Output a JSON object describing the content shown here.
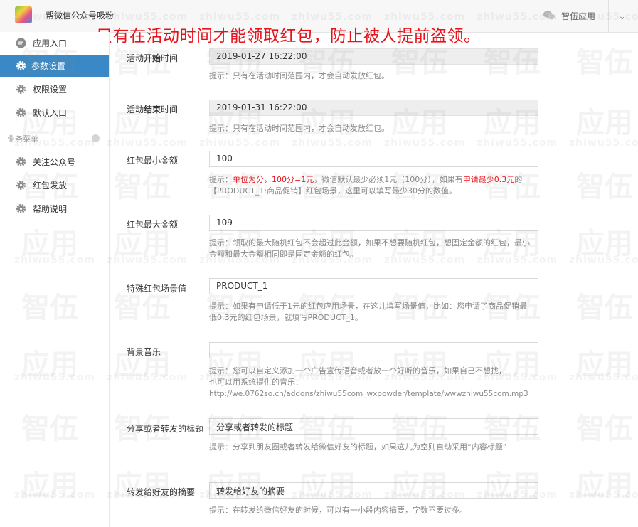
{
  "header": {
    "app_title": "帮微信公众号吸粉",
    "account_name": "智伍应用",
    "banner": "只有在活动时间才能领取红包，防止被人提前盗领。"
  },
  "sidebar": {
    "items": [
      {
        "label": "应用入口",
        "icon": "chat-bubble-icon",
        "active": false
      },
      {
        "label": "参数设置",
        "icon": "gear-icon",
        "active": true
      },
      {
        "label": "权限设置",
        "icon": "gear-icon",
        "active": false
      },
      {
        "label": "默认入口",
        "icon": "gear-icon",
        "active": false
      }
    ],
    "section_title": "业务菜单",
    "section_items": [
      {
        "label": "关注公众号",
        "icon": "gear-icon"
      },
      {
        "label": "红包发放",
        "icon": "gear-icon"
      },
      {
        "label": "帮助说明",
        "icon": "gear-icon"
      }
    ]
  },
  "form": {
    "start_time": {
      "label_pre": "活动",
      "label_bold": "开始",
      "label_post": "时间",
      "value": "2019-01-27 16:22:00",
      "hint": "提示：只有在活动时间范围内，才会自动发放红包。"
    },
    "end_time": {
      "label_pre": "活动",
      "label_bold": "结束",
      "label_post": "时间",
      "value": "2019-01-31 16:22:00",
      "hint": "提示：只有在活动时间范围内，才会自动发放红包。"
    },
    "min_amount": {
      "label": "红包最小金额",
      "value": "100",
      "hint_pre": "提示：",
      "hint_red1": "单位为分，100分=1元",
      "hint_mid": "，微信默认最少必须1元（100分），如果有",
      "hint_red2": "申请最少0.3元",
      "hint_post": "的【PRODUCT_1:商品促销】红包场景，这里可以填写最少30分的数值。"
    },
    "max_amount": {
      "label": "红包最大金额",
      "value": "109",
      "hint": "提示：领取的最大随机红包不会超过此金额，如果不想要随机红包，想固定金额的红包，最小金额和最大金额相同即是固定金额的红包。"
    },
    "scene_value": {
      "label": "特殊红包场景值",
      "value": "PRODUCT_1",
      "hint": "提示：如果有申请低于1元的红包应用场景，在这儿填写场景值，比如：您申请了商品促销最低0.3元的红包场景，就填写PRODUCT_1。"
    },
    "bg_music": {
      "label": "背景音乐",
      "value": "",
      "hint_line1": "提示：您可以自定义添加一个广告宣传语音或者放一个好听的音乐，如果自己不想找，",
      "hint_line2": "也可以用系统提供的音乐：",
      "hint_line3": "http://we.0762so.cn/addons/zhiwu55com_wxpowder/template/wwwzhiwu55com.mp3"
    },
    "share_title": {
      "label": "分享或者转发的标题",
      "value": "分享或者转发的标题",
      "hint": "提示：分享到朋友圈或者转发给微信好友的标题，如果这儿为空则自动采用“内容标题”"
    },
    "share_desc": {
      "label": "转发给好友的摘要",
      "value": "转发给好友的摘要",
      "hint": "提示：在转发给微信好友的时候，可以有一小段内容摘要，字数不要过多。"
    }
  },
  "watermark": {
    "domain": "zhiwu55.com",
    "big_top": "智伍",
    "big_bottom": "应用"
  }
}
